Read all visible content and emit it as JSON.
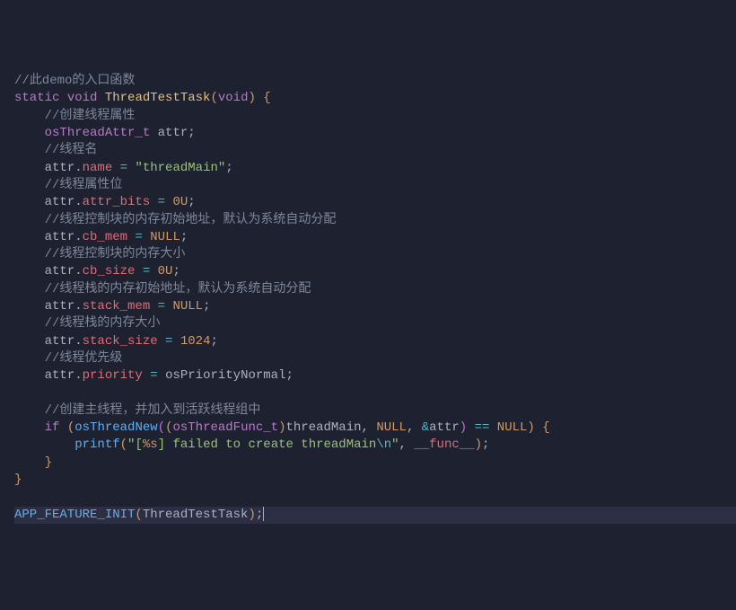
{
  "code": {
    "c1": "//此demo的入口函数",
    "kw_static": "static",
    "kw_void": "void",
    "fn_ThreadTestTask": "ThreadTestTask",
    "c2": "//创建线程属性",
    "type_osThreadAttr_t": "osThreadAttr_t",
    "id_attr": "attr",
    "c3": "//线程名",
    "p_name": "name",
    "s_threadMain": "\"threadMain\"",
    "c4": "//线程属性位",
    "p_attr_bits": "attr_bits",
    "n_0U_1": "0U",
    "c5": "//线程控制块的内存初始地址，默认为系统自动分配",
    "p_cb_mem": "cb_mem",
    "null1": "NULL",
    "c6": "//线程控制块的内存大小",
    "p_cb_size": "cb_size",
    "n_0U_2": "0U",
    "c7": "//线程栈的内存初始地址，默认为系统自动分配",
    "p_stack_mem": "stack_mem",
    "null2": "NULL",
    "c8": "//线程栈的内存大小",
    "p_stack_size": "stack_size",
    "n_1024": "1024",
    "c9": "//线程优先级",
    "p_priority": "priority",
    "id_osPriorityNormal": "osPriorityNormal",
    "c10": "//创建主线程，并加入到活跃线程组中",
    "kw_if": "if",
    "fn_osThreadNew": "osThreadNew",
    "type_osThreadFunc_t": "osThreadFunc_t",
    "id_threadMain": "threadMain",
    "null3": "NULL",
    "op_amp": "&",
    "null4": "NULL",
    "fn_printf": "printf",
    "s_printf_open": "\"[",
    "fmt_s": "%s",
    "s_printf_mid": "] failed to create threadMain",
    "esc_n": "\\n",
    "s_printf_close": "\"",
    "id_func": "__func__",
    "fn_APP_FEATURE_INIT": "APP_FEATURE_INIT",
    "op_eq": "=",
    "op_semi": ";",
    "op_comma": ",",
    "op_dot": ".",
    "op_eqeq": "=="
  }
}
